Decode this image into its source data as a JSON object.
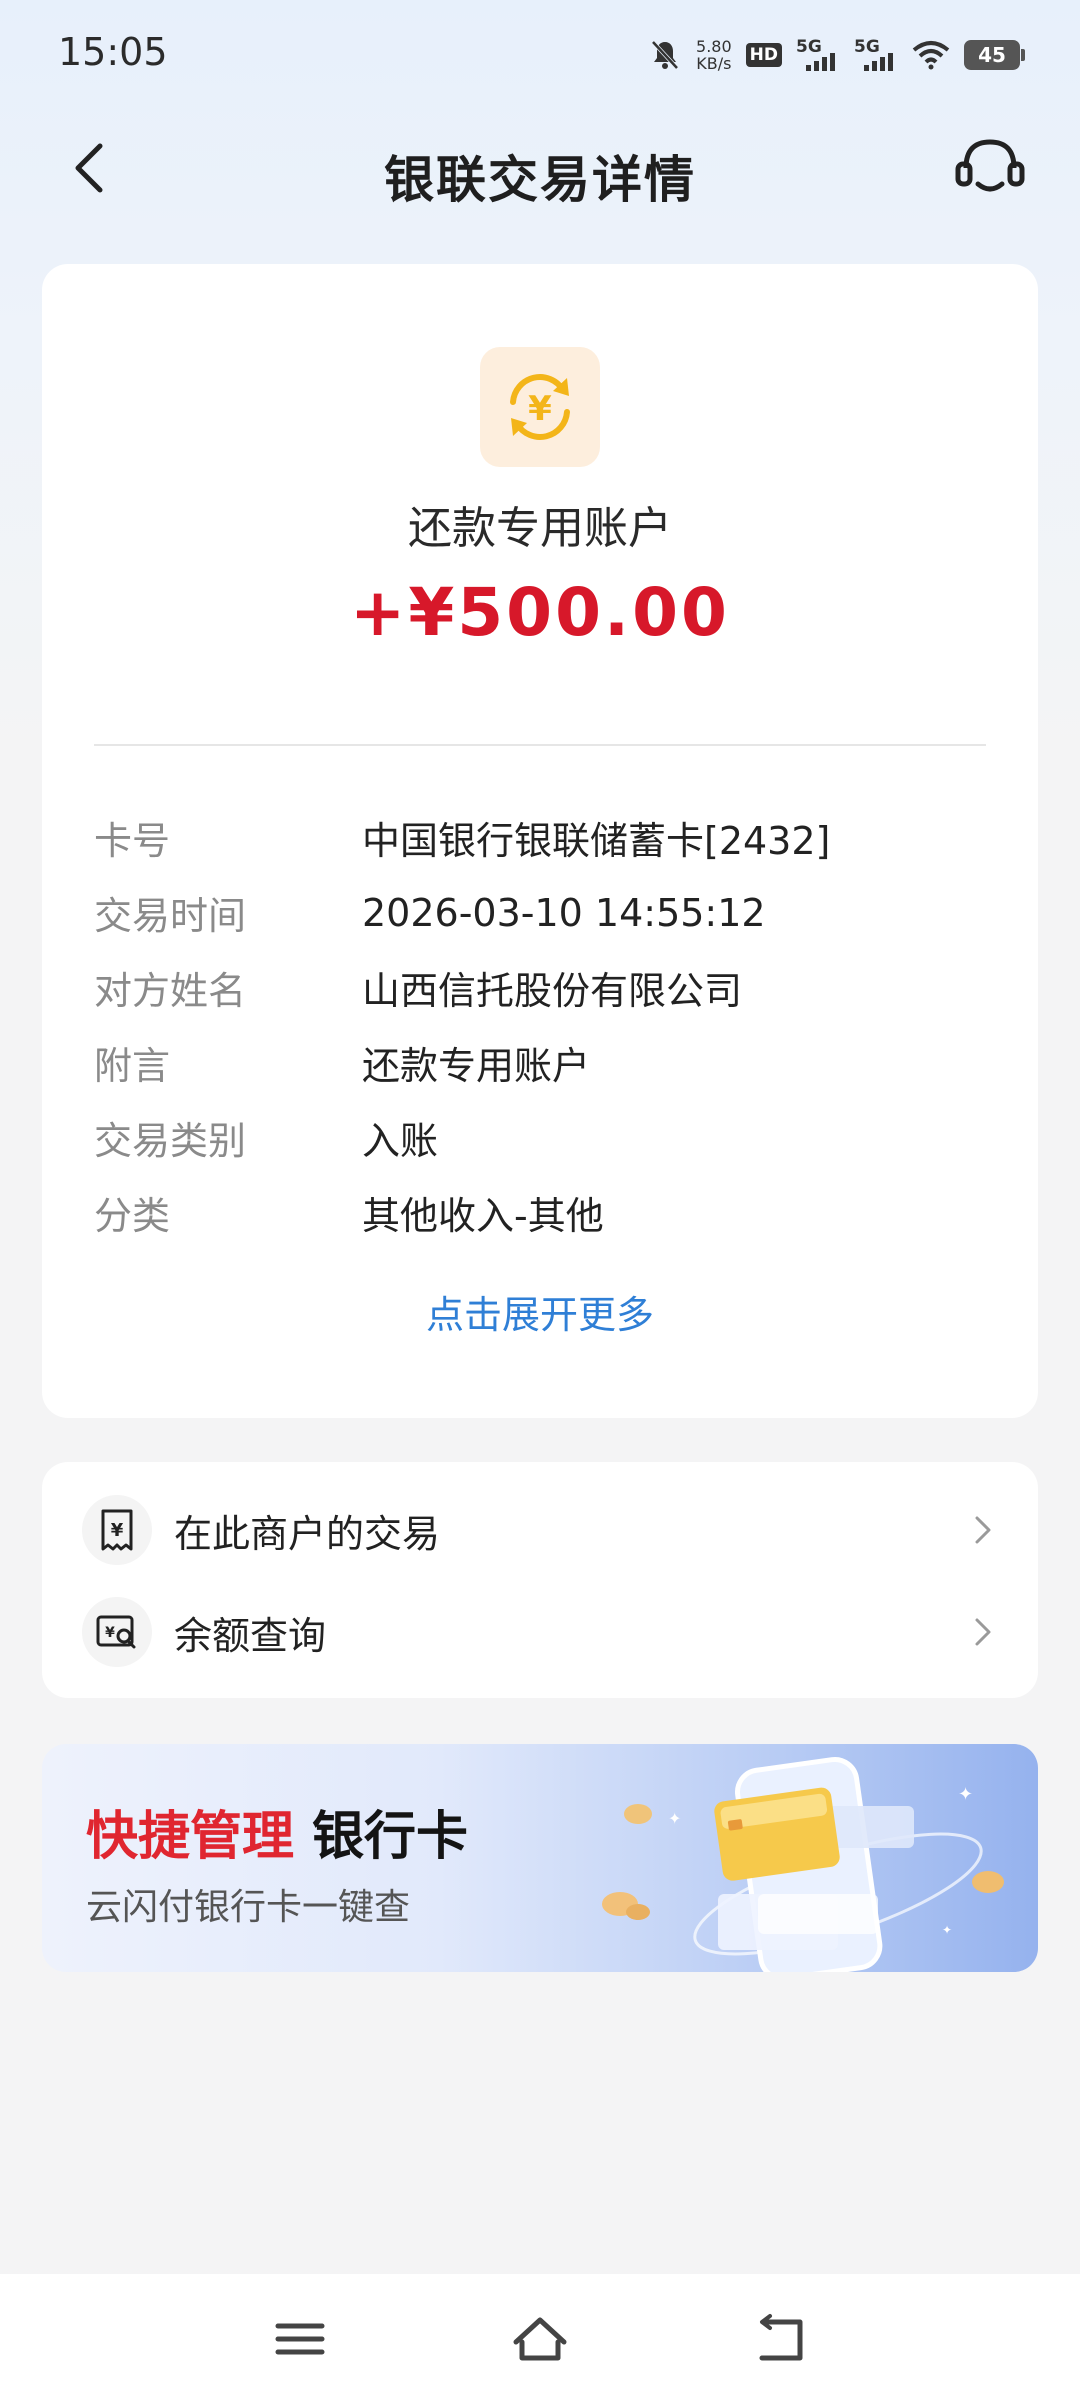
{
  "status_bar": {
    "time": "15:05",
    "speed_value": "5.80",
    "speed_unit": "KB/s",
    "hd_label": "HD",
    "net1": "5G",
    "net2": "5G",
    "battery": "45"
  },
  "header": {
    "title": "银联交易详情"
  },
  "transaction": {
    "account_name": "还款专用账户",
    "amount": "+¥500.00",
    "details": [
      {
        "key": "卡号",
        "value": "中国银行银联储蓄卡[2432]"
      },
      {
        "key": "交易时间",
        "value": "2026-03-10 14:55:12"
      },
      {
        "key": "对方姓名",
        "value": "山西信托股份有限公司"
      },
      {
        "key": "附言",
        "value": "还款专用账户"
      },
      {
        "key": "交易类别",
        "value": "入账"
      },
      {
        "key": "分类",
        "value": "其他收入-其他"
      }
    ],
    "expand_label": "点击展开更多"
  },
  "actions": [
    {
      "label": "在此商户的交易",
      "icon": "receipt-yuan-icon"
    },
    {
      "label": "余额查询",
      "icon": "balance-search-icon"
    }
  ],
  "banner": {
    "title_red": "快捷管理",
    "title_black": "银行卡",
    "subtitle": "云闪付银行卡一键查"
  },
  "colors": {
    "amount": "#d7182a",
    "link": "#2f7fd6",
    "banner_red": "#e02630",
    "icon_orange": "#f3b519"
  }
}
